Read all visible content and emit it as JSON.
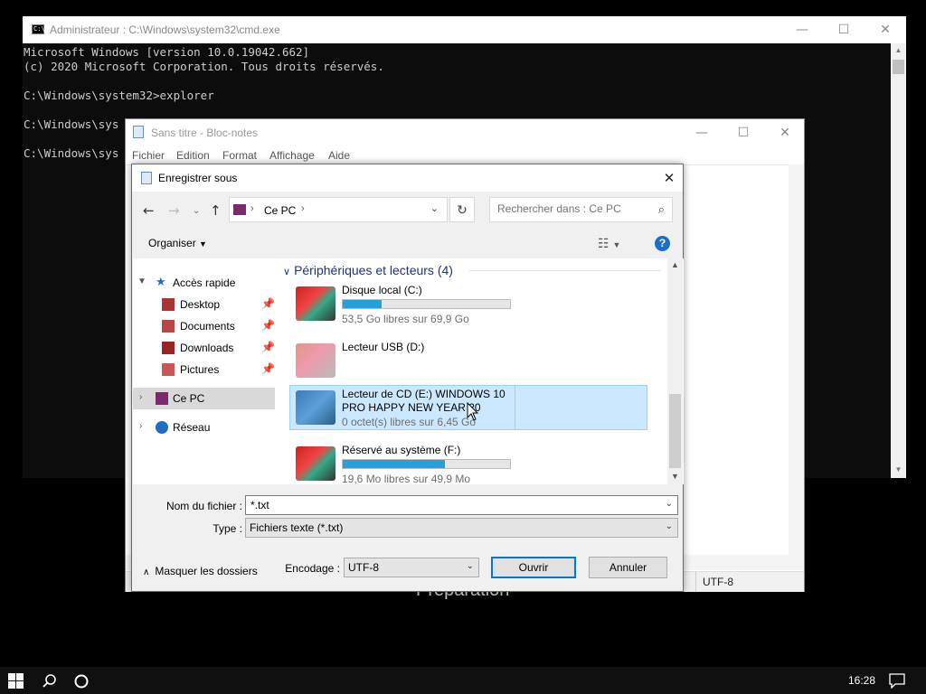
{
  "cmd": {
    "title": "Administrateur : C:\\Windows\\system32\\cmd.exe",
    "lines": [
      "Microsoft Windows [version 10.0.19042.662]",
      "(c) 2020 Microsoft Corporation. Tous droits réservés.",
      "",
      "C:\\Windows\\system32>explorer",
      "",
      "C:\\Windows\\sys",
      "",
      "C:\\Windows\\sys"
    ],
    "controls": {
      "minimize": "—",
      "maximize": "☐",
      "close": "✕"
    }
  },
  "notepad": {
    "title": "Sans titre - Bloc-notes",
    "menu": [
      "Fichier",
      "Edition",
      "Format",
      "Affichage",
      "Aide"
    ],
    "status_encoding": "UTF-8",
    "controls": {
      "minimize": "—",
      "maximize": "☐",
      "close": "✕"
    }
  },
  "background_text": "Préparation",
  "dialog": {
    "title": "Enregistrer sous",
    "close": "✕",
    "address": {
      "location": "Ce PC"
    },
    "search": {
      "placeholder": "Rechercher dans : Ce PC"
    },
    "organize_label": "Organiser",
    "help": "?",
    "nav": {
      "quick_access": "Accès rapide",
      "items": [
        {
          "label": "Desktop",
          "icon": "desktop-icon"
        },
        {
          "label": "Documents",
          "icon": "documents-icon"
        },
        {
          "label": "Downloads",
          "icon": "downloads-icon"
        },
        {
          "label": "Pictures",
          "icon": "pictures-icon"
        }
      ],
      "this_pc": "Ce PC",
      "network": "Réseau"
    },
    "group_title": "Périphériques et lecteurs (4)",
    "drives": [
      {
        "name": "Disque local (C:)",
        "info": "53,5 Go libres sur 69,9 Go",
        "used_fraction": 0.23,
        "icon": "hard-drive-icon"
      },
      {
        "name": "Lecteur USB (D:)",
        "info": "",
        "used_fraction": null,
        "icon": "usb-drive-icon"
      },
      {
        "name": "Lecteur de CD (E:) WINDOWS 10 PRO HAPPY NEW YEAR 20",
        "info": "0 octet(s) libres sur 6,45 Go",
        "used_fraction": null,
        "icon": "cd-drive-icon",
        "selected": true
      },
      {
        "name": "Réservé au système (F:)",
        "info": "19,6 Mo libres sur 49,9 Mo",
        "used_fraction": 0.61,
        "icon": "hard-drive-icon"
      }
    ],
    "filename_label": "Nom du fichier :",
    "filename_value": "*.txt",
    "type_label": "Type :",
    "type_value": "Fichiers texte (*.txt)",
    "hide_folders": "Masquer les dossiers",
    "encoding_label": "Encodage :",
    "encoding_value": "UTF-8",
    "save_button": "Ouvrir",
    "cancel_button": "Annuler"
  },
  "taskbar": {
    "time": "16:28"
  },
  "colors": {
    "accent": "#0078d7",
    "drive_bar": "#26a0da",
    "selection": "#cce8ff"
  }
}
